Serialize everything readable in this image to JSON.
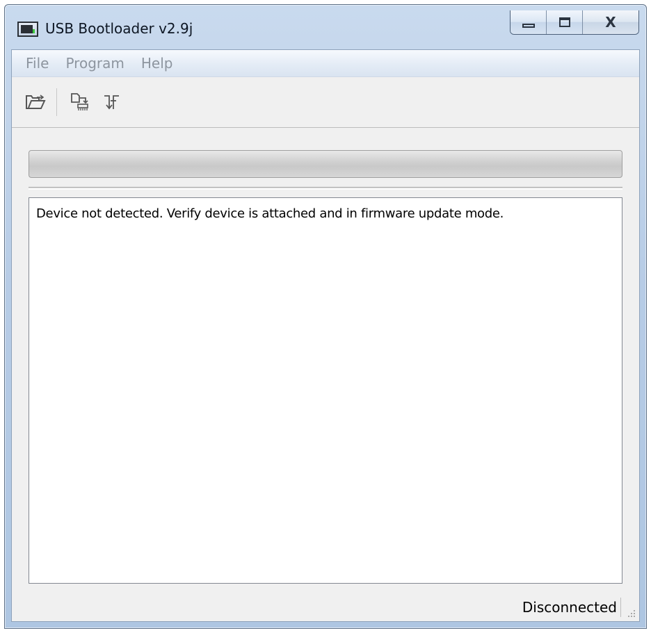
{
  "window": {
    "title": "USB Bootloader v2.9j",
    "icon": "usb-bootloader-app-icon",
    "caption_buttons": [
      {
        "name": "minimize",
        "icon": "minimize-icon"
      },
      {
        "name": "maximize",
        "icon": "maximize-icon"
      },
      {
        "name": "close",
        "icon": "close-icon",
        "glyph": "X"
      }
    ]
  },
  "menu": {
    "items": [
      "File",
      "Program",
      "Help"
    ],
    "enabled": false
  },
  "toolbar": {
    "buttons": [
      {
        "name": "open-hex-file",
        "icon": "open-folder-icon"
      },
      {
        "name": "program-device",
        "icon": "write-device-icon"
      },
      {
        "name": "reset-device",
        "icon": "reset-device-icon"
      }
    ]
  },
  "progress": {
    "value": 0
  },
  "log": {
    "lines": [
      "Device not detected.  Verify device is attached and in firmware update mode."
    ]
  },
  "status": {
    "text": "Disconnected"
  },
  "colors": {
    "titlebar": "#b7cce6",
    "client_bg": "#f0f0f0",
    "menu_disabled_text": "#8d959f",
    "progress_track": "#d1d1d1"
  }
}
